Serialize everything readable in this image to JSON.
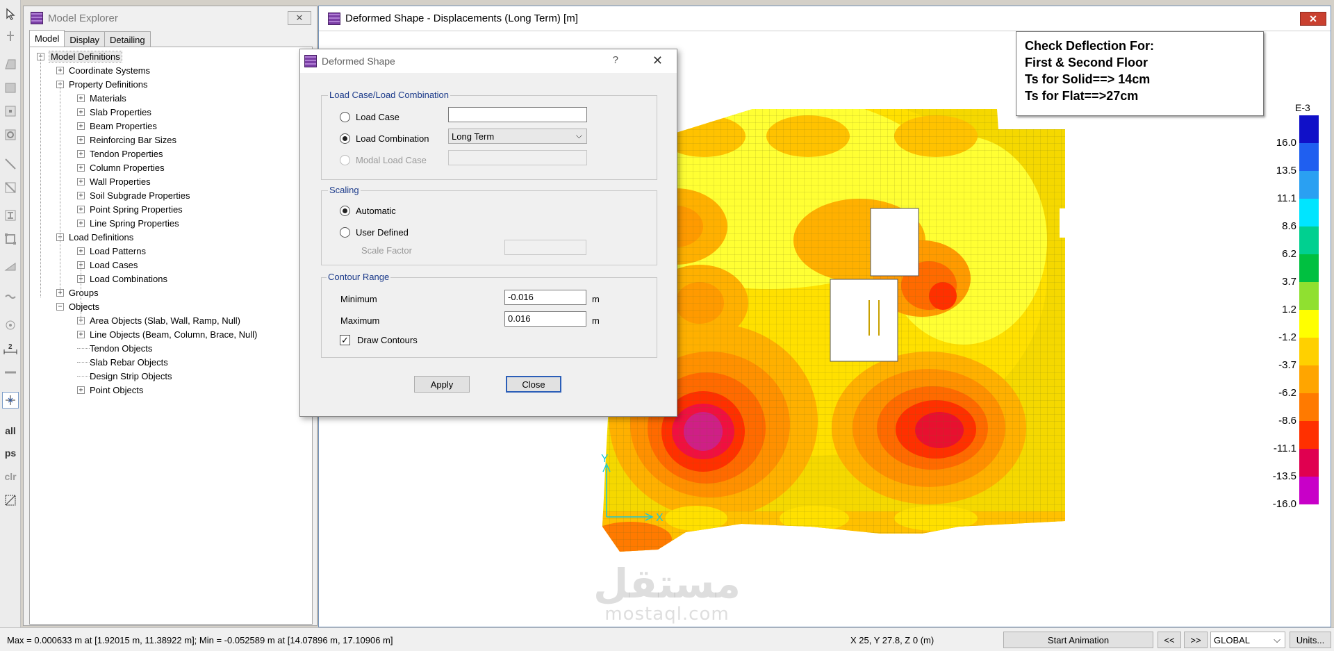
{
  "toolstrip": {
    "tools": [
      {
        "icon": "pointer-icon"
      },
      {
        "icon": "select-node-icon"
      },
      {
        "icon": "draw-area-icon"
      },
      {
        "icon": "draw-rect-icon"
      },
      {
        "icon": "draw-column-icon"
      },
      {
        "icon": "draw-circle-icon"
      },
      {
        "icon": "draw-line-icon"
      },
      {
        "icon": "draw-brace-icon"
      },
      {
        "icon": "draw-beam-icon"
      },
      {
        "icon": "draw-wall-icon"
      },
      {
        "icon": "draw-ramp-icon"
      },
      {
        "icon": "draw-strip-icon"
      },
      {
        "icon": "draw-point-icon"
      },
      {
        "icon": "dimension-icon"
      },
      {
        "icon": "ruler-icon"
      },
      {
        "icon": "snap-icon"
      }
    ],
    "all_label": "all",
    "ps_label": "ps",
    "clr_label": "clr"
  },
  "explorer": {
    "title": "Model Explorer",
    "tabs": [
      "Model",
      "Display",
      "Detailing"
    ],
    "active_tab": "Model",
    "tree": [
      {
        "label": "Model Definitions",
        "level": 0,
        "sign": "-"
      },
      {
        "label": "Coordinate Systems",
        "level": 1,
        "sign": "+"
      },
      {
        "label": "Property Definitions",
        "level": 1,
        "sign": "-"
      },
      {
        "label": "Materials",
        "level": 2,
        "sign": "+"
      },
      {
        "label": "Slab Properties",
        "level": 2,
        "sign": "+"
      },
      {
        "label": "Beam Properties",
        "level": 2,
        "sign": "+"
      },
      {
        "label": "Reinforcing Bar Sizes",
        "level": 2,
        "sign": "+"
      },
      {
        "label": "Tendon Properties",
        "level": 2,
        "sign": "+"
      },
      {
        "label": "Column Properties",
        "level": 2,
        "sign": "+"
      },
      {
        "label": "Wall Properties",
        "level": 2,
        "sign": "+"
      },
      {
        "label": "Soil Subgrade Properties",
        "level": 2,
        "sign": "+"
      },
      {
        "label": "Point Spring Properties",
        "level": 2,
        "sign": "+"
      },
      {
        "label": "Line Spring Properties",
        "level": 2,
        "sign": "+"
      },
      {
        "label": "Load Definitions",
        "level": 1,
        "sign": "-"
      },
      {
        "label": "Load Patterns",
        "level": 2,
        "sign": "+"
      },
      {
        "label": "Load Cases",
        "level": 2,
        "sign": "+"
      },
      {
        "label": "Load Combinations",
        "level": 2,
        "sign": "+"
      },
      {
        "label": "Groups",
        "level": 1,
        "sign": "+"
      },
      {
        "label": "Objects",
        "level": 1,
        "sign": "-"
      },
      {
        "label": "Area Objects (Slab, Wall, Ramp, Null)",
        "level": 2,
        "sign": "+"
      },
      {
        "label": "Line Objects (Beam, Column, Brace, Null)",
        "level": 2,
        "sign": "+"
      },
      {
        "label": "Tendon Objects",
        "level": 2,
        "sign": ""
      },
      {
        "label": "Slab Rebar Objects",
        "level": 2,
        "sign": ""
      },
      {
        "label": "Design Strip Objects",
        "level": 2,
        "sign": ""
      },
      {
        "label": "Point Objects",
        "level": 2,
        "sign": "+"
      }
    ]
  },
  "view": {
    "title": "Deformed Shape - Displacements (Long Term)  [m]",
    "note_lines": [
      "Check Deflection For:",
      "First & Second Floor",
      "Ts for Solid==> 14cm",
      "Ts for Flat==>27cm"
    ],
    "axis_y": "Y",
    "axis_x": "X",
    "legend": {
      "unit": "E-3",
      "labels": [
        "16.0",
        "13.5",
        "11.1",
        "8.6",
        "6.2",
        "3.7",
        "1.2",
        "-1.2",
        "-3.7",
        "-6.2",
        "-8.6",
        "-11.1",
        "-13.5",
        "-16.0"
      ],
      "colors": [
        "#1010c8",
        "#1f5ff0",
        "#2aa0f2",
        "#00e5ff",
        "#00d090",
        "#00c040",
        "#90e030",
        "#ffff00",
        "#ffd000",
        "#ffa500",
        "#ff7a00",
        "#ff3000",
        "#e00050",
        "#c800c8"
      ]
    }
  },
  "dialog": {
    "title": "Deformed Shape",
    "help": "?",
    "close_glyph": "✕",
    "group1": {
      "title": "Load Case/Load Combination",
      "opt_case": "Load Case",
      "opt_combo": "Load Combination",
      "opt_modal": "Modal Load Case",
      "combo_value": "Long Term",
      "selected": "Load Combination"
    },
    "group2": {
      "title": "Scaling",
      "opt_auto": "Automatic",
      "opt_user": "User Defined",
      "scale_label": "Scale Factor",
      "selected": "Automatic"
    },
    "group3": {
      "title": "Contour Range",
      "min_label": "Minimum",
      "min_value": "-0.016",
      "max_label": "Maximum",
      "max_value": "0.016",
      "unit": "m",
      "draw_contours_label": "Draw Contours",
      "draw_contours": true
    },
    "apply_label": "Apply",
    "close_label": "Close"
  },
  "status": {
    "minmax": "Max = 0.000633 m at [1.92015 m, 11.38922 m];  Min = -0.052589 m at [14.07896 m, 17.10906 m]",
    "coords": "X 25,  Y 27.8,  Z 0  (m)",
    "start_animation": "Start Animation",
    "prev": "<<",
    "next": ">>",
    "coord_system": "GLOBAL",
    "units_label": "Units..."
  },
  "watermark": {
    "arabic": "مستقل",
    "latin": "mostaql.com"
  }
}
